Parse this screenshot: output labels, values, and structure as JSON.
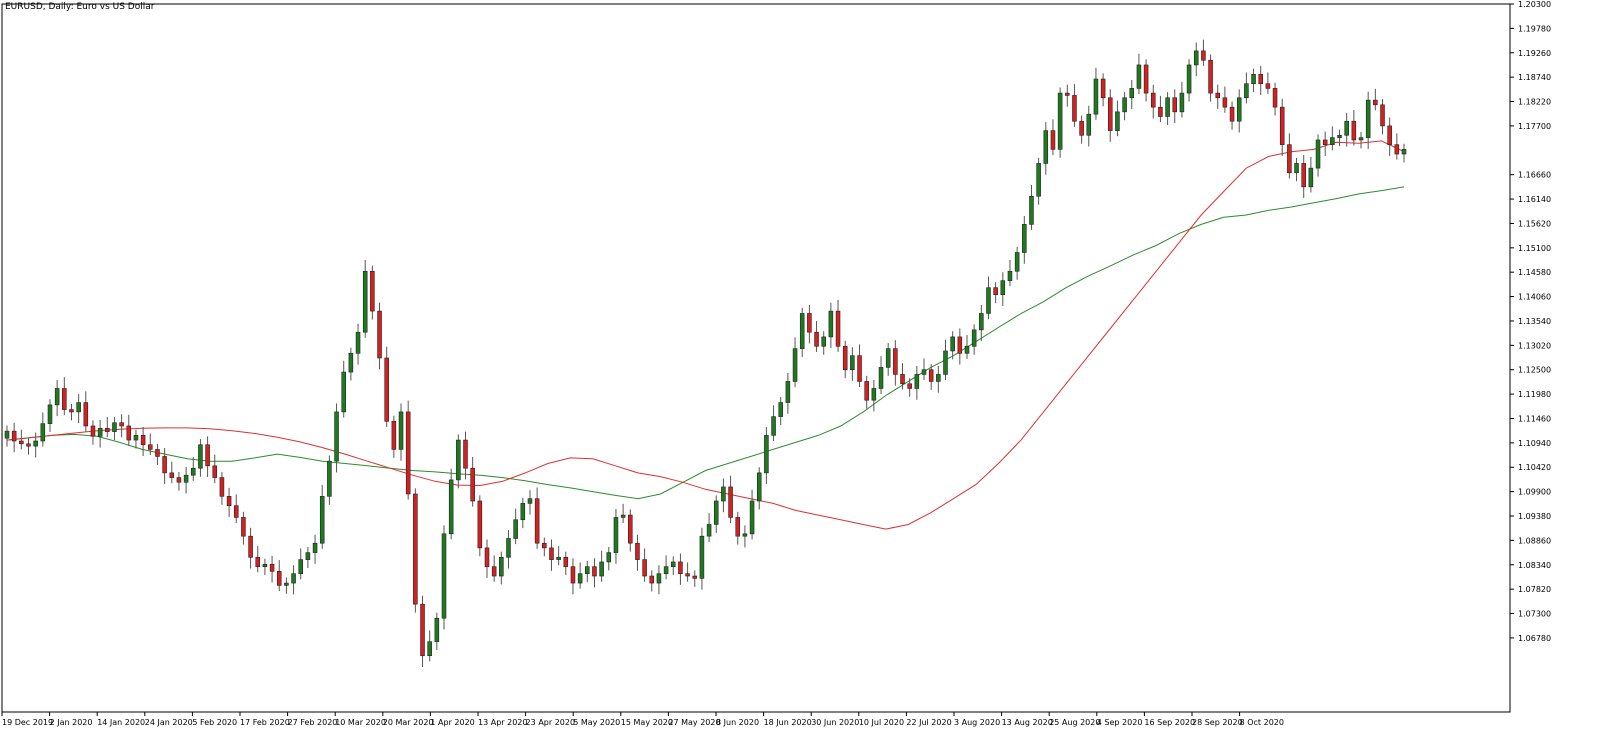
{
  "chart_data": {
    "type": "candlestick",
    "title": "EURUSD, Daily:  Euro vs US Dollar",
    "ylim": [
      1.052,
      1.203
    ],
    "y_ticks": [
      "1.20300",
      "1.19780",
      "1.19260",
      "1.18740",
      "1.18220",
      "1.17700",
      "1.16660",
      "1.16140",
      "1.15620",
      "1.15100",
      "1.14580",
      "1.14060",
      "1.13540",
      "1.13020",
      "1.12500",
      "1.11980",
      "1.11460",
      "1.10940",
      "1.10420",
      "1.09900",
      "1.09380",
      "1.08860",
      "1.08340",
      "1.07820",
      "1.07300",
      "1.06780"
    ],
    "x_ticks": [
      "19 Dec 2019",
      "2 Jan 2020",
      "14 Jan 2020",
      "24 Jan 2020",
      "5 Feb 2020",
      "17 Feb 2020",
      "27 Feb 2020",
      "10 Mar 2020",
      "20 Mar 2020",
      "1 Apr 2020",
      "13 Apr 2020",
      "23 Apr 2020",
      "5 May 2020",
      "15 May 2020",
      "27 May 2020",
      "8 Jun 2020",
      "18 Jun 2020",
      "30 Jun 2020",
      "10 Jul 2020",
      "22 Jul 2020",
      "3 Aug 2020",
      "13 Aug 2020",
      "25 Aug 2020",
      "4 Sep 2020",
      "16 Sep 2020",
      "28 Sep 2020",
      "8 Oct 2020"
    ],
    "bull_color": "#1e7a1e",
    "bear_color": "#d42020",
    "ma_fast_color": "#e03030",
    "ma_slow_color": "#2e8b2e",
    "closes": [
      1.1119,
      1.1098,
      1.1092,
      1.1087,
      1.1098,
      1.1135,
      1.1175,
      1.121,
      1.1165,
      1.116,
      1.118,
      1.113,
      1.1108,
      1.1125,
      1.1118,
      1.1137,
      1.113,
      1.11,
      1.111,
      1.109,
      1.108,
      1.1065,
      1.103,
      1.102,
      1.101,
      1.1025,
      1.104,
      1.109,
      1.1045,
      1.102,
      1.098,
      1.096,
      1.0935,
      1.0895,
      1.085,
      1.083,
      1.0835,
      1.082,
      1.079,
      1.0795,
      1.0815,
      1.0845,
      1.086,
      1.088,
      1.098,
      1.1055,
      1.116,
      1.1245,
      1.1285,
      1.133,
      1.146,
      1.1375,
      1.1275,
      1.114,
      1.108,
      1.116,
      1.0985,
      1.075,
      1.064,
      1.067,
      1.072,
      1.09,
      1.1015,
      1.11,
      1.104,
      1.097,
      1.087,
      1.083,
      1.081,
      1.085,
      1.089,
      1.093,
      1.0965,
      1.0975,
      1.088,
      1.087,
      1.0845,
      1.085,
      1.083,
      1.0795,
      1.0815,
      1.083,
      1.081,
      1.084,
      1.086,
      1.0935,
      1.094,
      1.088,
      1.0845,
      1.081,
      1.0795,
      1.0815,
      1.083,
      1.084,
      1.0815,
      1.081,
      1.0805,
      1.0895,
      1.092,
      1.097,
      1.1,
      1.0935,
      1.0895,
      1.09,
      1.097,
      1.103,
      1.111,
      1.115,
      1.118,
      1.1225,
      1.1295,
      1.137,
      1.133,
      1.13,
      1.132,
      1.1375,
      1.13,
      1.125,
      1.128,
      1.1225,
      1.1185,
      1.121,
      1.1255,
      1.1295,
      1.124,
      1.122,
      1.121,
      1.124,
      1.125,
      1.1225,
      1.124,
      1.129,
      1.132,
      1.1285,
      1.13,
      1.1335,
      1.137,
      1.1425,
      1.141,
      1.144,
      1.146,
      1.15,
      1.156,
      1.162,
      1.169,
      1.176,
      1.172,
      1.184,
      1.1835,
      1.178,
      1.175,
      1.1795,
      1.187,
      1.183,
      1.176,
      1.18,
      1.183,
      1.185,
      1.19,
      1.184,
      1.181,
      1.179,
      1.183,
      1.18,
      1.184,
      1.19,
      1.193,
      1.191,
      1.184,
      1.183,
      1.181,
      1.178,
      1.183,
      1.186,
      1.188,
      1.186,
      1.185,
      1.181,
      1.173,
      1.167,
      1.169,
      1.164,
      1.168,
      1.174,
      1.173,
      1.1745,
      1.175,
      1.178,
      1.174,
      1.1745,
      1.1825,
      1.1815,
      1.177,
      1.173,
      1.171,
      1.172
    ],
    "ma_fast": [
      1.11,
      1.1105,
      1.111,
      1.1115,
      1.112,
      1.1123,
      1.1125,
      1.1126,
      1.1126,
      1.1124,
      1.112,
      1.1114,
      1.1106,
      1.1096,
      1.1084,
      1.107,
      1.1055,
      1.104,
      1.1025,
      1.1012,
      1.1004,
      1.1003,
      1.1012,
      1.103,
      1.105,
      1.1062,
      1.106,
      1.1045,
      1.103,
      1.1022,
      1.101,
      1.0995,
      1.0985,
      1.0975,
      1.0965,
      1.095,
      1.094,
      1.093,
      1.092,
      1.091,
      1.092,
      1.0945,
      1.0975,
      1.1005,
      1.105,
      1.11,
      1.116,
      1.122,
      1.128,
      1.134,
      1.14,
      1.146,
      1.152,
      1.158,
      1.163,
      1.168,
      1.1705,
      1.1715,
      1.172,
      1.1735,
      1.1733,
      1.1738,
      1.1715
    ],
    "ma_slow": [
      1.11,
      1.1105,
      1.111,
      1.1112,
      1.1108,
      1.1095,
      1.108,
      1.107,
      1.106,
      1.1055,
      1.1055,
      1.1062,
      1.107,
      1.1063,
      1.1055,
      1.105,
      1.1045,
      1.104,
      1.1035,
      1.1032,
      1.1028,
      1.1025,
      1.102,
      1.1013,
      1.1005,
      1.0998,
      1.099,
      1.0982,
      1.0975,
      1.0985,
      1.101,
      1.1035,
      1.105,
      1.1065,
      1.108,
      1.1095,
      1.111,
      1.113,
      1.116,
      1.1195,
      1.1225,
      1.1255,
      1.128,
      1.131,
      1.134,
      1.137,
      1.1395,
      1.1425,
      1.145,
      1.1472,
      1.1495,
      1.1515,
      1.154,
      1.156,
      1.1575,
      1.158,
      1.159,
      1.1597,
      1.1606,
      1.1615,
      1.1625,
      1.1632,
      1.164
    ]
  }
}
